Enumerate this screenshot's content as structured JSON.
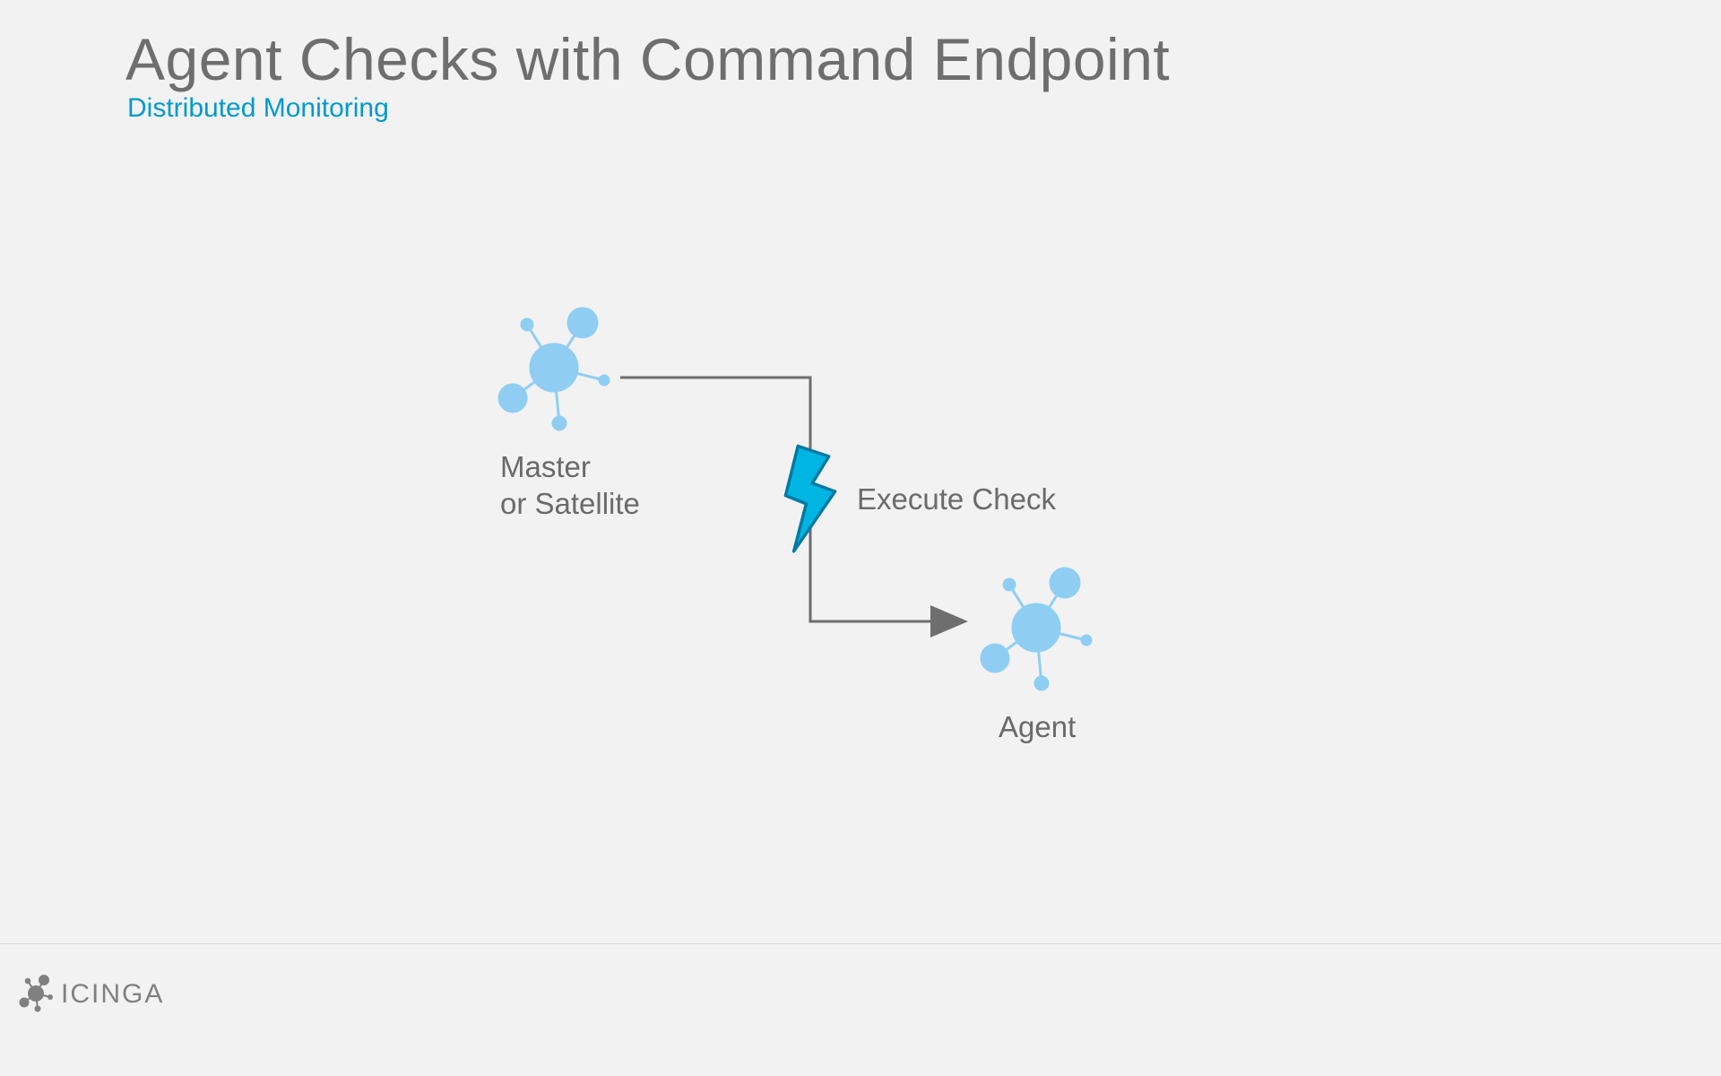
{
  "title": "Agent Checks with Command Endpoint",
  "subtitle": "Distributed Monitoring",
  "nodes": {
    "source_label": "Master\nor Satellite",
    "target_label": "Agent"
  },
  "edge_label": "Execute Check",
  "footer_brand": "ICINGA",
  "colors": {
    "node": "#8fcef2",
    "accent": "#0099cc",
    "bolt_fill": "#00b5e2",
    "bolt_stroke": "#007aa3",
    "arrow": "#6e6e6e"
  }
}
